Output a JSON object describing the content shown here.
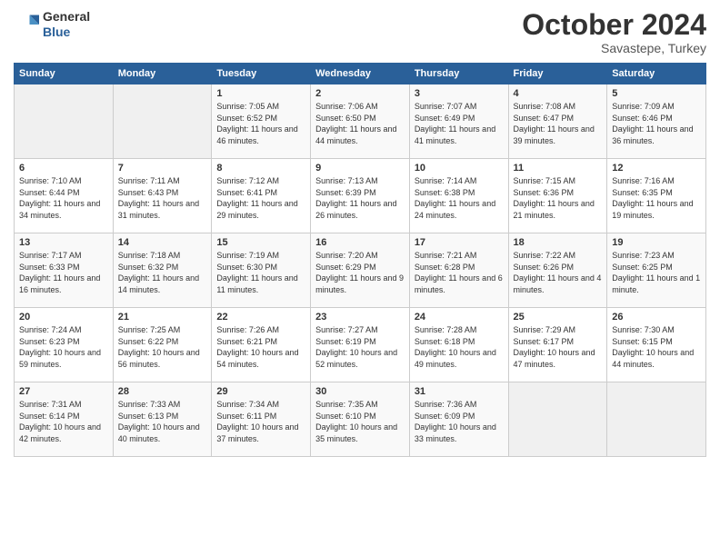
{
  "header": {
    "logo_general": "General",
    "logo_blue": "Blue",
    "month": "October 2024",
    "location": "Savastepe, Turkey"
  },
  "weekdays": [
    "Sunday",
    "Monday",
    "Tuesday",
    "Wednesday",
    "Thursday",
    "Friday",
    "Saturday"
  ],
  "weeks": [
    [
      {
        "day": "",
        "info": ""
      },
      {
        "day": "",
        "info": ""
      },
      {
        "day": "1",
        "info": "Sunrise: 7:05 AM\nSunset: 6:52 PM\nDaylight: 11 hours and 46 minutes."
      },
      {
        "day": "2",
        "info": "Sunrise: 7:06 AM\nSunset: 6:50 PM\nDaylight: 11 hours and 44 minutes."
      },
      {
        "day": "3",
        "info": "Sunrise: 7:07 AM\nSunset: 6:49 PM\nDaylight: 11 hours and 41 minutes."
      },
      {
        "day": "4",
        "info": "Sunrise: 7:08 AM\nSunset: 6:47 PM\nDaylight: 11 hours and 39 minutes."
      },
      {
        "day": "5",
        "info": "Sunrise: 7:09 AM\nSunset: 6:46 PM\nDaylight: 11 hours and 36 minutes."
      }
    ],
    [
      {
        "day": "6",
        "info": "Sunrise: 7:10 AM\nSunset: 6:44 PM\nDaylight: 11 hours and 34 minutes."
      },
      {
        "day": "7",
        "info": "Sunrise: 7:11 AM\nSunset: 6:43 PM\nDaylight: 11 hours and 31 minutes."
      },
      {
        "day": "8",
        "info": "Sunrise: 7:12 AM\nSunset: 6:41 PM\nDaylight: 11 hours and 29 minutes."
      },
      {
        "day": "9",
        "info": "Sunrise: 7:13 AM\nSunset: 6:39 PM\nDaylight: 11 hours and 26 minutes."
      },
      {
        "day": "10",
        "info": "Sunrise: 7:14 AM\nSunset: 6:38 PM\nDaylight: 11 hours and 24 minutes."
      },
      {
        "day": "11",
        "info": "Sunrise: 7:15 AM\nSunset: 6:36 PM\nDaylight: 11 hours and 21 minutes."
      },
      {
        "day": "12",
        "info": "Sunrise: 7:16 AM\nSunset: 6:35 PM\nDaylight: 11 hours and 19 minutes."
      }
    ],
    [
      {
        "day": "13",
        "info": "Sunrise: 7:17 AM\nSunset: 6:33 PM\nDaylight: 11 hours and 16 minutes."
      },
      {
        "day": "14",
        "info": "Sunrise: 7:18 AM\nSunset: 6:32 PM\nDaylight: 11 hours and 14 minutes."
      },
      {
        "day": "15",
        "info": "Sunrise: 7:19 AM\nSunset: 6:30 PM\nDaylight: 11 hours and 11 minutes."
      },
      {
        "day": "16",
        "info": "Sunrise: 7:20 AM\nSunset: 6:29 PM\nDaylight: 11 hours and 9 minutes."
      },
      {
        "day": "17",
        "info": "Sunrise: 7:21 AM\nSunset: 6:28 PM\nDaylight: 11 hours and 6 minutes."
      },
      {
        "day": "18",
        "info": "Sunrise: 7:22 AM\nSunset: 6:26 PM\nDaylight: 11 hours and 4 minutes."
      },
      {
        "day": "19",
        "info": "Sunrise: 7:23 AM\nSunset: 6:25 PM\nDaylight: 11 hours and 1 minute."
      }
    ],
    [
      {
        "day": "20",
        "info": "Sunrise: 7:24 AM\nSunset: 6:23 PM\nDaylight: 10 hours and 59 minutes."
      },
      {
        "day": "21",
        "info": "Sunrise: 7:25 AM\nSunset: 6:22 PM\nDaylight: 10 hours and 56 minutes."
      },
      {
        "day": "22",
        "info": "Sunrise: 7:26 AM\nSunset: 6:21 PM\nDaylight: 10 hours and 54 minutes."
      },
      {
        "day": "23",
        "info": "Sunrise: 7:27 AM\nSunset: 6:19 PM\nDaylight: 10 hours and 52 minutes."
      },
      {
        "day": "24",
        "info": "Sunrise: 7:28 AM\nSunset: 6:18 PM\nDaylight: 10 hours and 49 minutes."
      },
      {
        "day": "25",
        "info": "Sunrise: 7:29 AM\nSunset: 6:17 PM\nDaylight: 10 hours and 47 minutes."
      },
      {
        "day": "26",
        "info": "Sunrise: 7:30 AM\nSunset: 6:15 PM\nDaylight: 10 hours and 44 minutes."
      }
    ],
    [
      {
        "day": "27",
        "info": "Sunrise: 7:31 AM\nSunset: 6:14 PM\nDaylight: 10 hours and 42 minutes."
      },
      {
        "day": "28",
        "info": "Sunrise: 7:33 AM\nSunset: 6:13 PM\nDaylight: 10 hours and 40 minutes."
      },
      {
        "day": "29",
        "info": "Sunrise: 7:34 AM\nSunset: 6:11 PM\nDaylight: 10 hours and 37 minutes."
      },
      {
        "day": "30",
        "info": "Sunrise: 7:35 AM\nSunset: 6:10 PM\nDaylight: 10 hours and 35 minutes."
      },
      {
        "day": "31",
        "info": "Sunrise: 7:36 AM\nSunset: 6:09 PM\nDaylight: 10 hours and 33 minutes."
      },
      {
        "day": "",
        "info": ""
      },
      {
        "day": "",
        "info": ""
      }
    ]
  ]
}
